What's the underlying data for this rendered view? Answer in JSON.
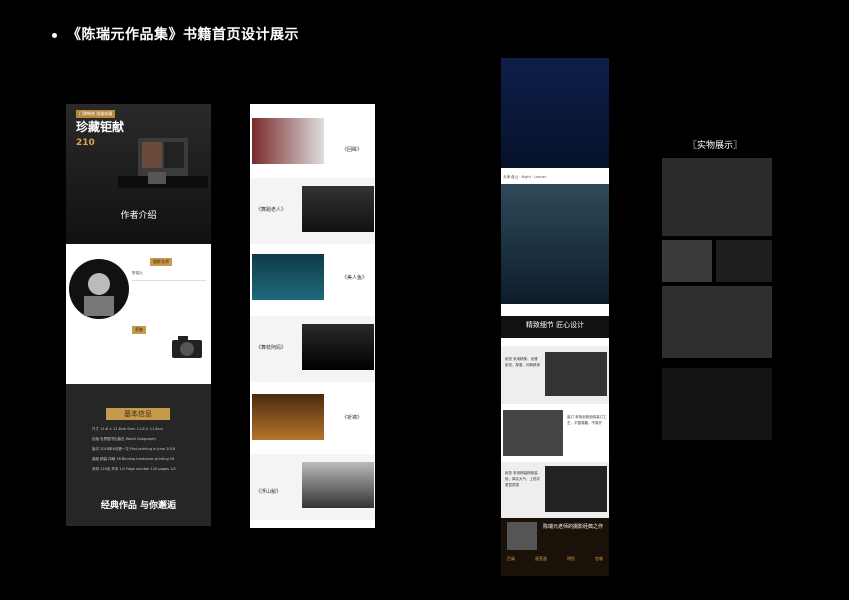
{
  "page_title": "《陈瑞元作品集》书籍首页设计展示",
  "col1": {
    "badge": "门票畅销 限量收藏",
    "headline": "珍藏钜献",
    "price_label": "210",
    "section_author": "作者介绍",
    "author_tag": "摄影名师",
    "author_name": "陈瑞元",
    "honor_tag": "荣誉",
    "info_title": "基本信息",
    "info_lines": [
      "尺寸 11.8 × 11.8cm   Size: 11.8 × 11.8cm",
      "出版 世界图书出版社   World Geography",
      "版次 2018年6月第一次  First printing in June 2018",
      "装帧 精装   印刷 16  Binding hardcover printing 16",
      "页码 120页   开本 1/2  Page number 120 pages 1/2"
    ],
    "tagline": "经典作品 与你邂逅"
  },
  "col2": {
    "labels": [
      "《回眸》",
      "《舞蹈老人》",
      "《美人鱼》",
      "《舞枝阿妈》",
      "《祈祷》",
      "《浮山秘》"
    ]
  },
  "col3": {
    "caption_small": "天津·盘山 · Night · Leader",
    "banner": "精致细节 匠心设计",
    "detail_texts": [
      "纸张 采用精美、优雅纸张，厚重，印刷精良",
      "装订 采用全新锁线装订工艺，平整易翻，不易开",
      "纸张 采用精装精致装帧，厚实大气，上档次更显质感"
    ],
    "promo": "陈瑞元老师的摄影经典之作",
    "nav_items": [
      "目录",
      "画签画",
      "明信",
      "包装"
    ]
  },
  "col4": {
    "label": "〖实物展示〗"
  }
}
